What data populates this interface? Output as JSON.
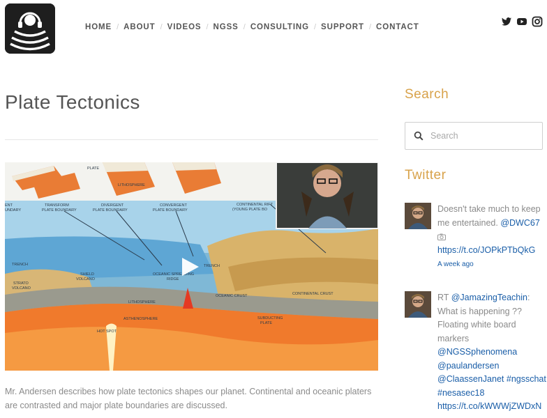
{
  "header": {
    "nav": [
      "HOME",
      "ABOUT",
      "VIDEOS",
      "NGSS",
      "CONSULTING",
      "SUPPORT",
      "CONTACT"
    ],
    "social_icons": [
      "twitter-icon",
      "youtube-icon",
      "instagram-icon"
    ]
  },
  "post": {
    "title": "Plate Tectonics",
    "description": "Mr. Andersen describes how plate tectonics shapes our planet. Continental and oceanic platers are contrasted and major plate boundaries are discussed.",
    "video": {
      "labels": {
        "plate": "PLATE",
        "lithosphere_top": "LITHOSPHERE",
        "transform": "TRANSFORM",
        "transform_2": "PLATE BOUNDARY",
        "divergent": "DIVERGENT",
        "divergent_2": "PLATE BOUNDARY",
        "convergent": "CONVERGENT",
        "convergent_2": "PLATE BOUNDARY",
        "continental": "CONTINENTAL RIFT",
        "continental_2": "(YOUNG PLATE BO",
        "ent": "ENT",
        "undary": "UNDARY",
        "trench_left": "TRENCH",
        "shield": "SHIELD",
        "shield_2": "VOLCANO",
        "strato": "STRATO",
        "strato_2": "VOLCANO",
        "oceanic_spreading": "OCEANIC SPREADING",
        "ridge": "RIDGE",
        "trench_right": "TRENCH",
        "oceanic_crust": "OCEANIC CRUST",
        "continental_crust": "CONTINENTAL CRUST",
        "lithosphere": "LITHOSPHERE",
        "asthenosphere": "ASTHENOSPHERE",
        "hot_spot": "HOT SPOT",
        "subducting": "SUBDUCTING",
        "subducting_2": "PLATE"
      },
      "play_icon": "play-icon"
    }
  },
  "sidebar": {
    "search": {
      "heading": "Search",
      "placeholder": "Search"
    },
    "twitter": {
      "heading": "Twitter",
      "tweets": [
        {
          "text": "Doesn't take much to keep me entertained. ",
          "mention": "@DWC67",
          "link": "https://t.co/JOPkPTbQkG",
          "time": "A week ago"
        },
        {
          "prefix": "RT ",
          "mention": "@JamazingTeachin",
          "text": ": What is happening ?? Floating white board markers ",
          "tags": [
            "@NGSSphenomena",
            "@paulandersen",
            "@ClaassenJanet",
            "#ngsschat",
            "#nesasec18"
          ],
          "link": "https://t.co/kWWWjZWDxN"
        }
      ]
    }
  }
}
